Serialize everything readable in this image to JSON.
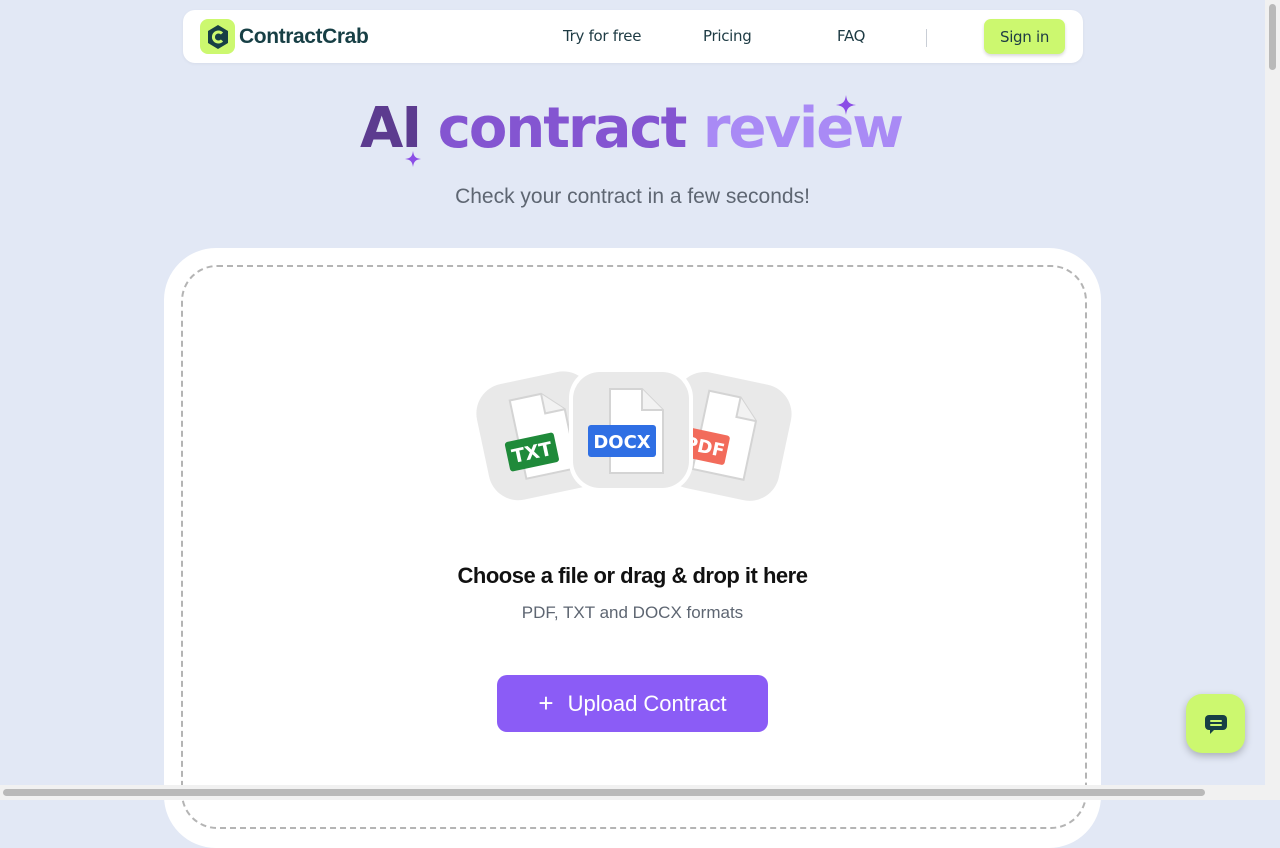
{
  "nav": {
    "brand": "ContractCrab",
    "links": [
      "Try for free",
      "Pricing",
      "FAQ"
    ],
    "signin": "Sign in"
  },
  "hero": {
    "title_words": [
      "AI",
      "contract",
      "review"
    ],
    "subtitle": "Check your contract in a few seconds!"
  },
  "upload": {
    "file_badges": [
      "TXT",
      "DOCX",
      "PDF"
    ],
    "title": "Choose a file or drag & drop it here",
    "formats": "PDF, TXT and DOCX formats",
    "button_label": "Upload Contract"
  },
  "colors": {
    "accent_lime": "#ccf86f",
    "accent_purple": "#8b5cf6",
    "background": "#e2e8f5"
  },
  "icons": [
    "brand-logo-icon",
    "sparkle-icon",
    "file-icon",
    "plus-icon",
    "chat-icon"
  ]
}
